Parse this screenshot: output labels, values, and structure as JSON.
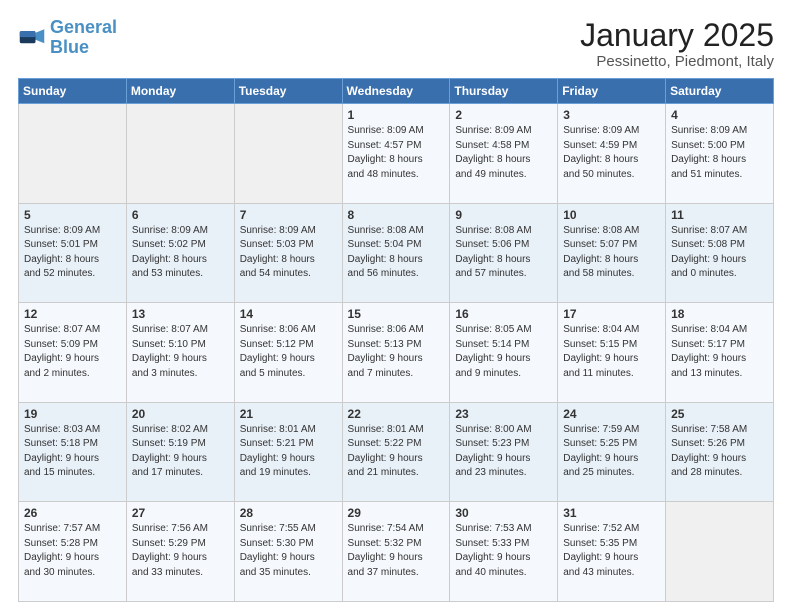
{
  "logo": {
    "line1": "General",
    "line2": "Blue"
  },
  "title": "January 2025",
  "subtitle": "Pessinetto, Piedmont, Italy",
  "weekdays": [
    "Sunday",
    "Monday",
    "Tuesday",
    "Wednesday",
    "Thursday",
    "Friday",
    "Saturday"
  ],
  "weeks": [
    [
      {
        "day": "",
        "info": ""
      },
      {
        "day": "",
        "info": ""
      },
      {
        "day": "",
        "info": ""
      },
      {
        "day": "1",
        "info": "Sunrise: 8:09 AM\nSunset: 4:57 PM\nDaylight: 8 hours\nand 48 minutes."
      },
      {
        "day": "2",
        "info": "Sunrise: 8:09 AM\nSunset: 4:58 PM\nDaylight: 8 hours\nand 49 minutes."
      },
      {
        "day": "3",
        "info": "Sunrise: 8:09 AM\nSunset: 4:59 PM\nDaylight: 8 hours\nand 50 minutes."
      },
      {
        "day": "4",
        "info": "Sunrise: 8:09 AM\nSunset: 5:00 PM\nDaylight: 8 hours\nand 51 minutes."
      }
    ],
    [
      {
        "day": "5",
        "info": "Sunrise: 8:09 AM\nSunset: 5:01 PM\nDaylight: 8 hours\nand 52 minutes."
      },
      {
        "day": "6",
        "info": "Sunrise: 8:09 AM\nSunset: 5:02 PM\nDaylight: 8 hours\nand 53 minutes."
      },
      {
        "day": "7",
        "info": "Sunrise: 8:09 AM\nSunset: 5:03 PM\nDaylight: 8 hours\nand 54 minutes."
      },
      {
        "day": "8",
        "info": "Sunrise: 8:08 AM\nSunset: 5:04 PM\nDaylight: 8 hours\nand 56 minutes."
      },
      {
        "day": "9",
        "info": "Sunrise: 8:08 AM\nSunset: 5:06 PM\nDaylight: 8 hours\nand 57 minutes."
      },
      {
        "day": "10",
        "info": "Sunrise: 8:08 AM\nSunset: 5:07 PM\nDaylight: 8 hours\nand 58 minutes."
      },
      {
        "day": "11",
        "info": "Sunrise: 8:07 AM\nSunset: 5:08 PM\nDaylight: 9 hours\nand 0 minutes."
      }
    ],
    [
      {
        "day": "12",
        "info": "Sunrise: 8:07 AM\nSunset: 5:09 PM\nDaylight: 9 hours\nand 2 minutes."
      },
      {
        "day": "13",
        "info": "Sunrise: 8:07 AM\nSunset: 5:10 PM\nDaylight: 9 hours\nand 3 minutes."
      },
      {
        "day": "14",
        "info": "Sunrise: 8:06 AM\nSunset: 5:12 PM\nDaylight: 9 hours\nand 5 minutes."
      },
      {
        "day": "15",
        "info": "Sunrise: 8:06 AM\nSunset: 5:13 PM\nDaylight: 9 hours\nand 7 minutes."
      },
      {
        "day": "16",
        "info": "Sunrise: 8:05 AM\nSunset: 5:14 PM\nDaylight: 9 hours\nand 9 minutes."
      },
      {
        "day": "17",
        "info": "Sunrise: 8:04 AM\nSunset: 5:15 PM\nDaylight: 9 hours\nand 11 minutes."
      },
      {
        "day": "18",
        "info": "Sunrise: 8:04 AM\nSunset: 5:17 PM\nDaylight: 9 hours\nand 13 minutes."
      }
    ],
    [
      {
        "day": "19",
        "info": "Sunrise: 8:03 AM\nSunset: 5:18 PM\nDaylight: 9 hours\nand 15 minutes."
      },
      {
        "day": "20",
        "info": "Sunrise: 8:02 AM\nSunset: 5:19 PM\nDaylight: 9 hours\nand 17 minutes."
      },
      {
        "day": "21",
        "info": "Sunrise: 8:01 AM\nSunset: 5:21 PM\nDaylight: 9 hours\nand 19 minutes."
      },
      {
        "day": "22",
        "info": "Sunrise: 8:01 AM\nSunset: 5:22 PM\nDaylight: 9 hours\nand 21 minutes."
      },
      {
        "day": "23",
        "info": "Sunrise: 8:00 AM\nSunset: 5:23 PM\nDaylight: 9 hours\nand 23 minutes."
      },
      {
        "day": "24",
        "info": "Sunrise: 7:59 AM\nSunset: 5:25 PM\nDaylight: 9 hours\nand 25 minutes."
      },
      {
        "day": "25",
        "info": "Sunrise: 7:58 AM\nSunset: 5:26 PM\nDaylight: 9 hours\nand 28 minutes."
      }
    ],
    [
      {
        "day": "26",
        "info": "Sunrise: 7:57 AM\nSunset: 5:28 PM\nDaylight: 9 hours\nand 30 minutes."
      },
      {
        "day": "27",
        "info": "Sunrise: 7:56 AM\nSunset: 5:29 PM\nDaylight: 9 hours\nand 33 minutes."
      },
      {
        "day": "28",
        "info": "Sunrise: 7:55 AM\nSunset: 5:30 PM\nDaylight: 9 hours\nand 35 minutes."
      },
      {
        "day": "29",
        "info": "Sunrise: 7:54 AM\nSunset: 5:32 PM\nDaylight: 9 hours\nand 37 minutes."
      },
      {
        "day": "30",
        "info": "Sunrise: 7:53 AM\nSunset: 5:33 PM\nDaylight: 9 hours\nand 40 minutes."
      },
      {
        "day": "31",
        "info": "Sunrise: 7:52 AM\nSunset: 5:35 PM\nDaylight: 9 hours\nand 43 minutes."
      },
      {
        "day": "",
        "info": ""
      }
    ]
  ]
}
